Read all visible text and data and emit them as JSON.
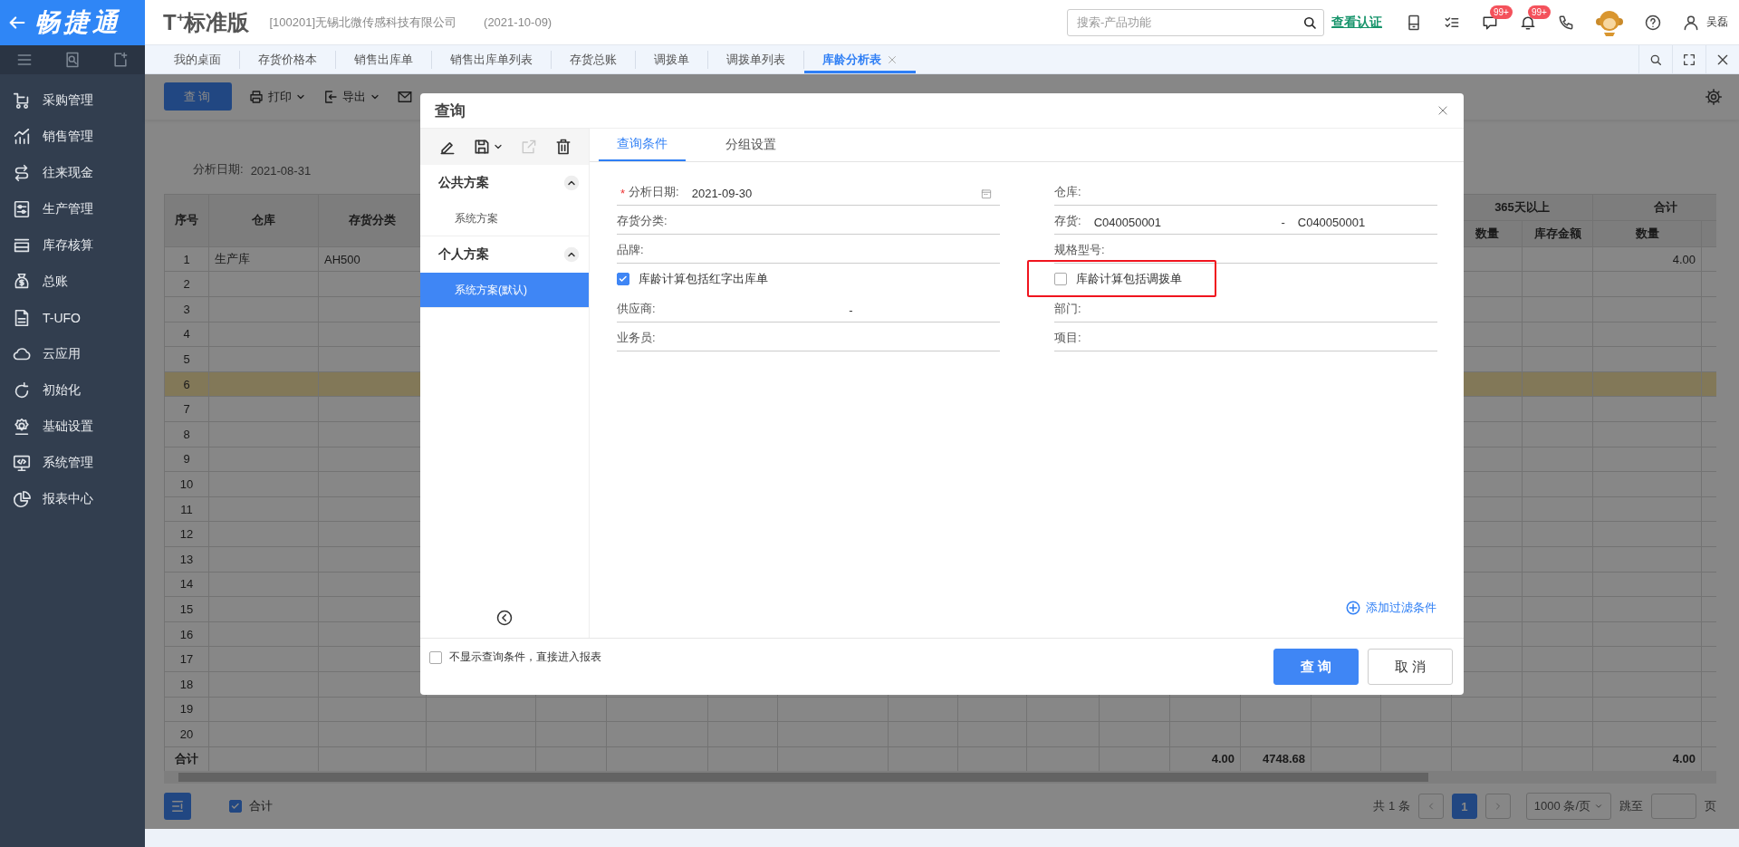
{
  "top_bar": {
    "app_name": "畅捷通",
    "product": "T$^{+}$标准版",
    "company": "[100201]无锡北微传感科技有限公司",
    "date": "(2021-10-09)",
    "search": {
      "placeholder": "搜索-产品功能"
    },
    "verify_link": "查看认证",
    "message_badge": "99+",
    "notification_badge": "99+",
    "user_name": "吴磊"
  },
  "tabs": [
    {
      "label": "我的桌面",
      "selected": false
    },
    {
      "label": "存货价格本",
      "selected": false
    },
    {
      "label": "销售出库单",
      "selected": false
    },
    {
      "label": "销售出库单列表",
      "selected": false
    },
    {
      "label": "存货总账",
      "selected": false
    },
    {
      "label": "调拨单",
      "selected": false
    },
    {
      "label": "调拨单列表",
      "selected": false
    },
    {
      "label": "库龄分析表",
      "selected": true
    }
  ],
  "sidebar": {
    "items": [
      "采购管理",
      "销售管理",
      "往来现金",
      "生产管理",
      "库存核算",
      "总账",
      "T-UFO",
      "云应用",
      "初始化",
      "基础设置",
      "系统管理",
      "报表中心"
    ]
  },
  "report": {
    "toolbar": {
      "query_button": "查询",
      "print": "打印",
      "export": "导出"
    },
    "filter": {
      "label": "分析日期:",
      "value": "2021-08-31"
    },
    "table": {
      "header": {
        "column_1": "序号",
        "column_2": "仓库",
        "column_3": "存货分类",
        "column_17": "数量",
        "column_18": "库存金额",
        "column_19": "数量"
      },
      "groups": {
        "column_17": "365天以上",
        "column_19": "合计"
      },
      "rows": [
        {
          "selected": false,
          "cells": {
            "column_1": "1",
            "column_2": "生产库",
            "column_3": "AH500",
            "column_19": "4.00"
          }
        },
        {
          "selected": false,
          "cells": {
            "column_1": "2"
          }
        },
        {
          "selected": false,
          "cells": {
            "column_1": "3"
          }
        },
        {
          "selected": false,
          "cells": {
            "column_1": "4"
          }
        },
        {
          "selected": false,
          "cells": {
            "column_1": "5"
          }
        },
        {
          "selected": true,
          "cells": {
            "column_1": "6"
          }
        },
        {
          "selected": false,
          "cells": {
            "column_1": "7"
          }
        },
        {
          "selected": false,
          "cells": {
            "column_1": "8"
          }
        },
        {
          "selected": false,
          "cells": {
            "column_1": "9"
          }
        },
        {
          "selected": false,
          "cells": {
            "column_1": "10"
          }
        },
        {
          "selected": false,
          "cells": {
            "column_1": "11"
          }
        },
        {
          "selected": false,
          "cells": {
            "column_1": "12"
          }
        },
        {
          "selected": false,
          "cells": {
            "column_1": "13"
          }
        },
        {
          "selected": false,
          "cells": {
            "column_1": "14"
          }
        },
        {
          "selected": false,
          "cells": {
            "column_1": "15"
          }
        },
        {
          "selected": false,
          "cells": {
            "column_1": "16"
          }
        },
        {
          "selected": false,
          "cells": {
            "column_1": "17"
          }
        },
        {
          "selected": false,
          "cells": {
            "column_1": "18"
          }
        },
        {
          "selected": false,
          "cells": {
            "column_1": "19"
          }
        },
        {
          "selected": false,
          "cells": {
            "column_1": "20"
          }
        }
      ],
      "totals": {
        "column_1": "合计",
        "column_13": "4.00",
        "column_14": "4748.68",
        "column_19": "4.00"
      }
    },
    "footer": {
      "total_checkbox": {
        "label": "合计",
        "checked": true
      },
      "summary": "共 1 条",
      "pages": [
        {
          "label": "1",
          "selected": true
        }
      ],
      "page_size": "1000 条/页",
      "jump_label": "跳至",
      "page_unit": "页"
    }
  },
  "dialog": {
    "title": "查询",
    "scheme_groups": [
      {
        "label": "公共方案",
        "expanded": true,
        "items": [
          {
            "label": "系统方案",
            "selected": false
          }
        ]
      },
      {
        "label": "个人方案",
        "expanded": true,
        "items": [
          {
            "label": "系统方案(默认)",
            "selected": true
          }
        ]
      }
    ],
    "tabs": [
      {
        "label": "查询条件",
        "selected": true
      },
      {
        "label": "分组设置",
        "selected": false
      }
    ],
    "form": {
      "left": [
        {
          "kind": "field",
          "label": "分析日期:",
          "required_mark": "*",
          "value": "2021-09-30",
          "calendar_button": true
        },
        {
          "kind": "field",
          "label": "存货分类:"
        },
        {
          "kind": "field",
          "label": "品牌:"
        },
        {
          "kind": "checkbox",
          "label": "库龄计算包括红字出库单",
          "checked": true
        },
        {
          "kind": "range",
          "label": "供应商:",
          "separator": "-"
        },
        {
          "kind": "field",
          "label": "业务员:"
        }
      ],
      "right": [
        {
          "kind": "field",
          "label": "仓库:"
        },
        {
          "kind": "range",
          "label": "存货:",
          "from": "C040050001",
          "separator": "-",
          "to": "C040050001"
        },
        {
          "kind": "field",
          "label": "规格型号:"
        },
        {
          "kind": "checkbox",
          "label": "库龄计算包括调拨单",
          "checked": false,
          "highlighted": true
        },
        {
          "kind": "field",
          "label": "部门:"
        },
        {
          "kind": "field",
          "label": "项目:"
        }
      ]
    },
    "add_filter": "添加过滤条件",
    "skip_checkbox": {
      "label": "不显示查询条件，直接进入报表",
      "checked": false
    },
    "buttons": [
      {
        "label": "查 询",
        "kind": "primary"
      },
      {
        "label": "取 消",
        "kind": "default"
      }
    ]
  }
}
